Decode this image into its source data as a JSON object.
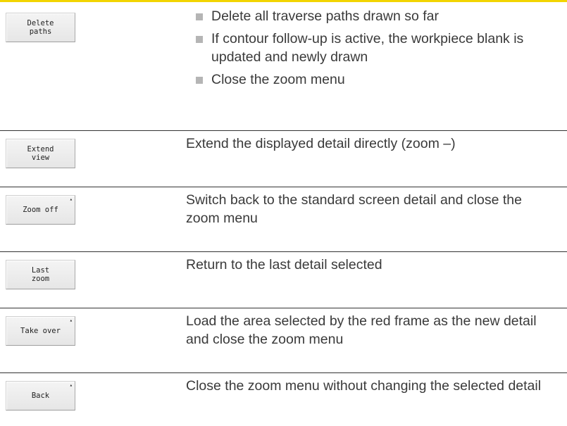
{
  "rows": [
    {
      "softkey": "Delete\npaths",
      "bullets": [
        "Delete all traverse paths drawn so far",
        "If contour follow-up is active, the workpiece blank is updated and newly drawn",
        "Close the zoom menu"
      ]
    },
    {
      "softkey": "Extend\nview",
      "text": "Extend the displayed detail directly (zoom –)"
    },
    {
      "softkey": "Zoom off",
      "mark": "▴",
      "text": "Switch back to the standard screen detail and close the zoom menu"
    },
    {
      "softkey": "Last\nzoom",
      "text": "Return to the last detail selected"
    },
    {
      "softkey": "Take over",
      "mark": "▴",
      "text": "Load the area selected by the red frame as the new detail and close the zoom menu"
    },
    {
      "softkey": "Back",
      "mark": "▴",
      "text": "Close the zoom menu without changing the selected detail"
    }
  ]
}
